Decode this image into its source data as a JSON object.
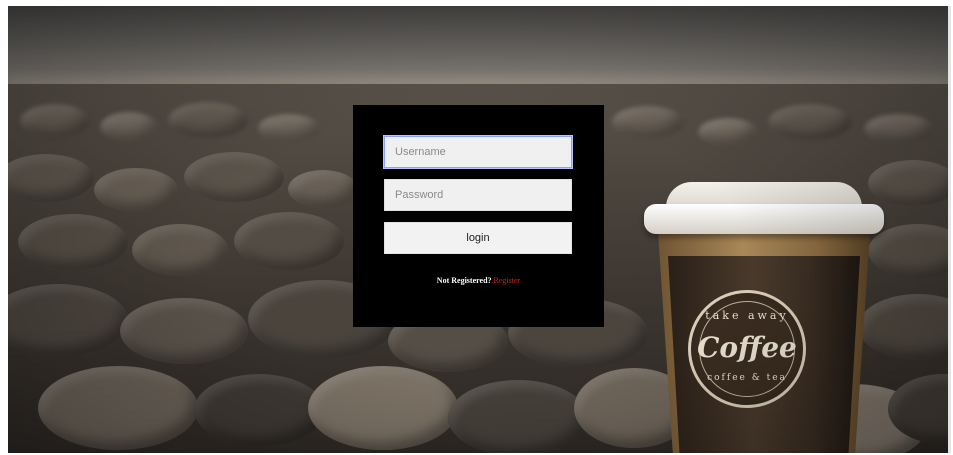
{
  "login": {
    "username_placeholder": "Username",
    "password_placeholder": "Password",
    "login_label": "login",
    "register_prompt": "Not Registered?",
    "register_link": "Register"
  },
  "cup": {
    "text_top": "take away",
    "text_main": "Coffee",
    "text_bottom": "coffee & tea"
  },
  "colors": {
    "panel_bg": "#000000",
    "register_link": "#d02020",
    "input_focus_border": "#8aa0ff"
  }
}
